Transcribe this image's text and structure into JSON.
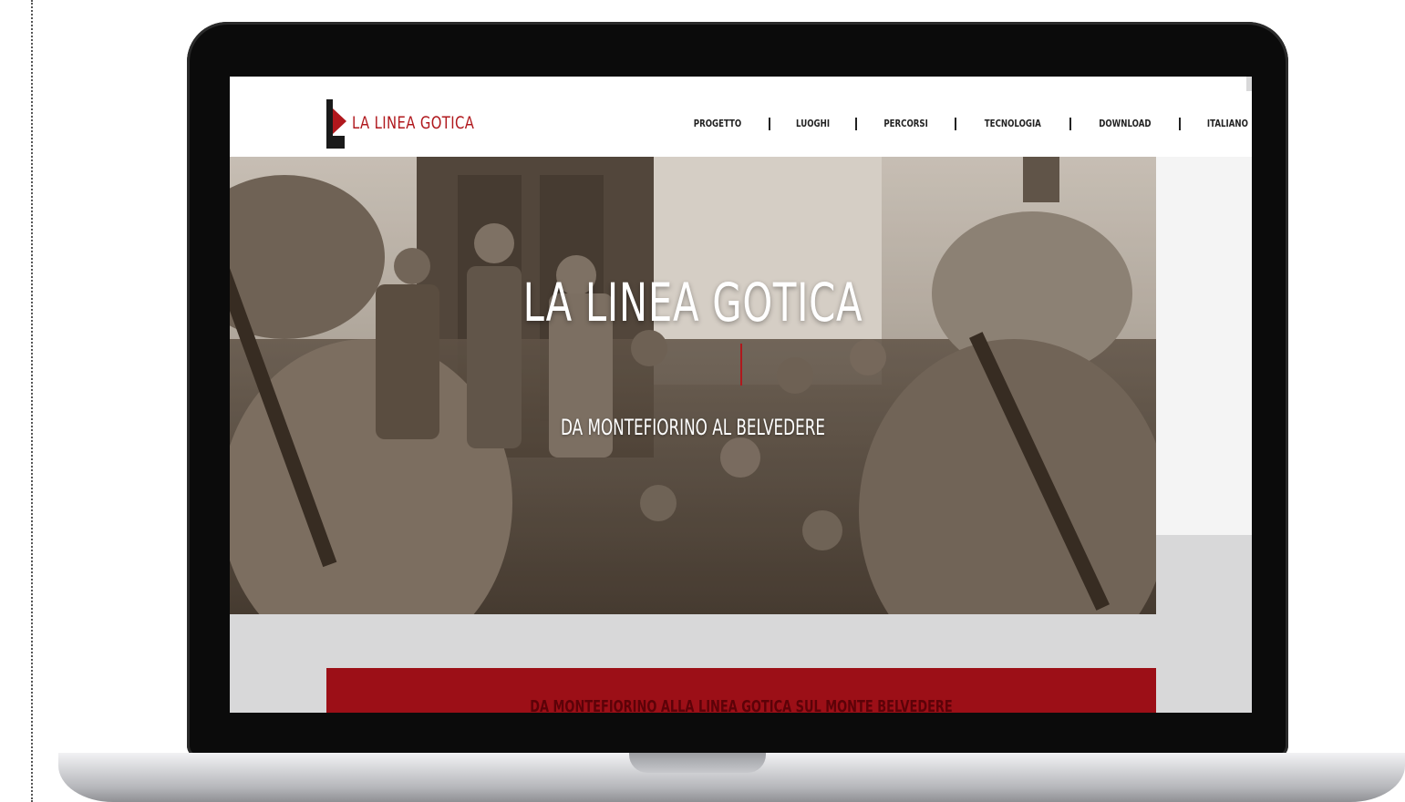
{
  "site": {
    "logo_text": "LA LINEA GOTICA",
    "brand_color": "#b0181d"
  },
  "nav": {
    "items": [
      "PROGETTO",
      "LUOGHI",
      "PERCORSI",
      "TECNOLOGIA",
      "DOWNLOAD"
    ],
    "language": "ITALIANO"
  },
  "hero": {
    "title": "LA LINEA GOTICA",
    "subtitle": "DA MONTEFIORINO AL BELVEDERE"
  },
  "banner": {
    "text": "DA MONTEFIORINO ALLA LINEA GOTICA SUL MONTE BELVEDERE",
    "color": "#9c0f17"
  }
}
